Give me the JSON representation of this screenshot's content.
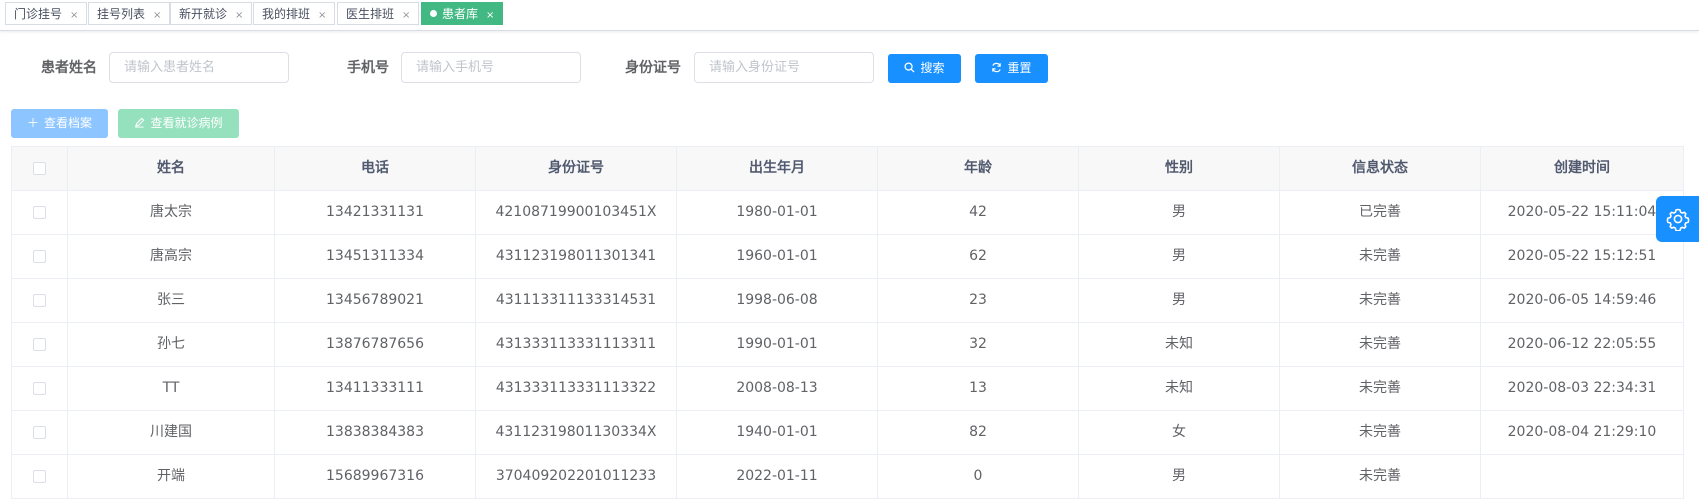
{
  "tags": [
    {
      "label": "门诊挂号",
      "active": false
    },
    {
      "label": "挂号列表",
      "active": false
    },
    {
      "label": "新开就诊",
      "active": false
    },
    {
      "label": "我的排班",
      "active": false
    },
    {
      "label": "医生排班",
      "active": false
    },
    {
      "label": "患者库",
      "active": true
    }
  ],
  "tag_close": "×",
  "search": {
    "name_label": "患者姓名",
    "name_placeholder": "请输入患者姓名",
    "phone_label": "手机号",
    "phone_placeholder": "请输入手机号",
    "id_label": "身份证号",
    "id_placeholder": "请输入身份证号",
    "search_button": "搜索",
    "reset_button": "重置"
  },
  "toolbar": {
    "view_record": "查看档案",
    "view_case": "查看就诊病例"
  },
  "table": {
    "columns": [
      "姓名",
      "电话",
      "身份证号",
      "出生年月",
      "年龄",
      "性别",
      "信息状态",
      "创建时间"
    ],
    "rows": [
      [
        "唐太宗",
        "13421331131",
        "42108719900103451X",
        "1980-01-01",
        "42",
        "男",
        "已完善",
        "2020-05-22 15:11:04"
      ],
      [
        "唐高宗",
        "13451311334",
        "431123198011301341",
        "1960-01-01",
        "62",
        "男",
        "未完善",
        "2020-05-22 15:12:51"
      ],
      [
        "张三",
        "13456789021",
        "431113311133314531",
        "1998-06-08",
        "23",
        "男",
        "未完善",
        "2020-06-05 14:59:46"
      ],
      [
        "孙七",
        "13876787656",
        "431333113331113311",
        "1990-01-01",
        "32",
        "未知",
        "未完善",
        "2020-06-12 22:05:55"
      ],
      [
        "TT",
        "13411333111",
        "431333113331113322",
        "2008-08-13",
        "13",
        "未知",
        "未完善",
        "2020-08-03 22:34:31"
      ],
      [
        "川建国",
        "13838384383",
        "43112319801130334X",
        "1940-01-01",
        "82",
        "女",
        "未完善",
        "2020-08-04 21:29:10"
      ],
      [
        "开端",
        "15689967316",
        "370409202201011233",
        "2022-01-11",
        "0",
        "男",
        "未完善",
        ""
      ]
    ]
  },
  "colors": {
    "primary": "#1890ff",
    "active_tag": "#42b983"
  }
}
